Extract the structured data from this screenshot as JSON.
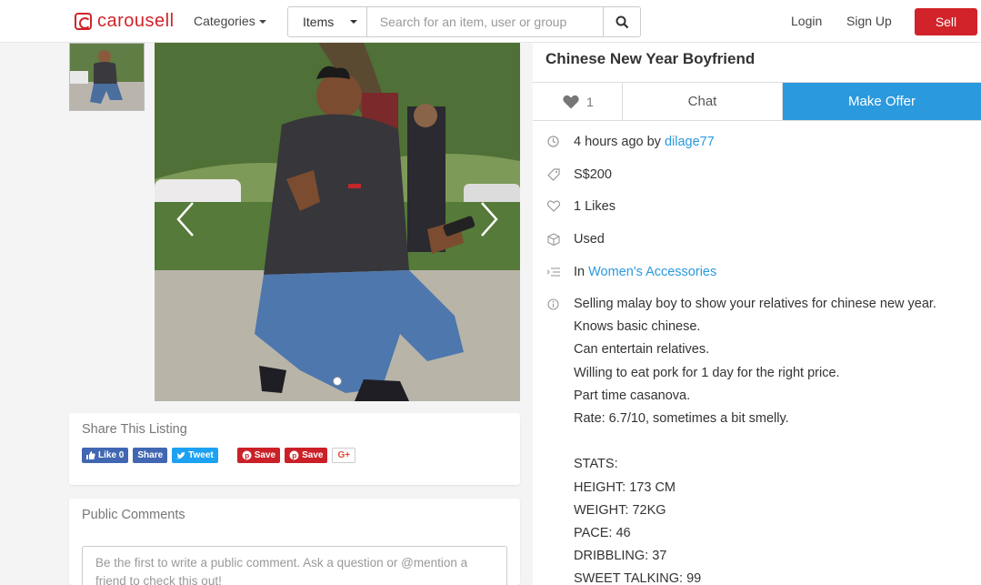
{
  "nav": {
    "logo_text": "carousell",
    "categories_label": "Categories",
    "search_type": "Items",
    "search_placeholder": "Search for an item, user or group",
    "login_label": "Login",
    "signup_label": "Sign Up",
    "sell_label": "Sell"
  },
  "colors": {
    "brand": "#d2232a",
    "accent": "#2b99dd"
  },
  "gallery": {
    "image_count": 1,
    "active_index": 0
  },
  "share": {
    "title": "Share This Listing",
    "buttons": [
      "Like 0",
      "Share",
      "Tweet",
      "Save",
      "Save",
      "G+"
    ]
  },
  "comments": {
    "title": "Public Comments",
    "placeholder_line1": "Be the first to write a public comment. Ask a question or @mention a",
    "placeholder_line2": "friend to check this out!"
  },
  "listing": {
    "title": "Chinese New Year Boyfriend",
    "like_count": "1",
    "chat_label": "Chat",
    "offer_label": "Make Offer",
    "posted_time": "4 hours ago by ",
    "seller": "dilage77",
    "price": "S$200",
    "likes_text": "1 Likes",
    "condition": "Used",
    "category_prefix": "In ",
    "category": "Women's Accessories",
    "description": [
      "Selling malay boy to show your relatives for chinese new year.",
      "Knows basic chinese.",
      "Can entertain relatives.",
      "Willing to eat pork for 1 day for the right price.",
      "Part time casanova.",
      "Rate: 6.7/10, sometimes a bit smelly.",
      "",
      "STATS:",
      "HEIGHT: 173 CM",
      "WEIGHT: 72KG",
      "PACE: 46",
      "DRIBBLING: 37",
      "SWEET TALKING: 99"
    ]
  }
}
